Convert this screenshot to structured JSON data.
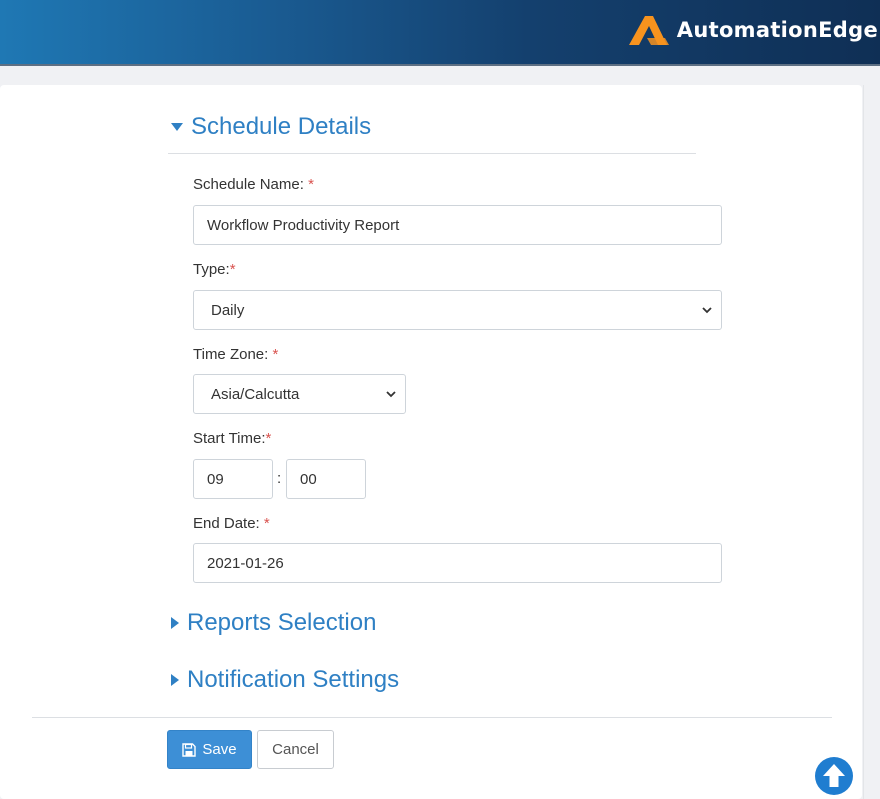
{
  "header": {
    "brand_name": "AutomationEdge",
    "logo_icon": "automationedge-logo-icon",
    "brand_color": "#f7931e"
  },
  "sections": {
    "schedule_details": {
      "label": "Schedule Details",
      "expanded": true
    },
    "reports_selection": {
      "label": "Reports Selection",
      "expanded": false
    },
    "notification_settings": {
      "label": "Notification Settings",
      "expanded": false
    }
  },
  "form": {
    "schedule_name": {
      "label": "Schedule Name:",
      "required_mark": "*",
      "value": "Workflow Productivity Report"
    },
    "type": {
      "label": "Type:",
      "required_mark": "*",
      "value": "Daily"
    },
    "time_zone": {
      "label": "Time Zone:",
      "required_mark": "*",
      "value": "Asia/Calcutta"
    },
    "start_time": {
      "label": "Start Time:",
      "required_mark": "*",
      "hour": "09",
      "separator": ":",
      "minute": "00"
    },
    "end_date": {
      "label": "End Date:",
      "required_mark": "*",
      "value": "2021-01-26"
    }
  },
  "actions": {
    "save_label": "Save",
    "cancel_label": "Cancel"
  },
  "colors": {
    "accent": "#2f80c4",
    "save_button": "#3d8fd6",
    "required": "#d9534f"
  }
}
